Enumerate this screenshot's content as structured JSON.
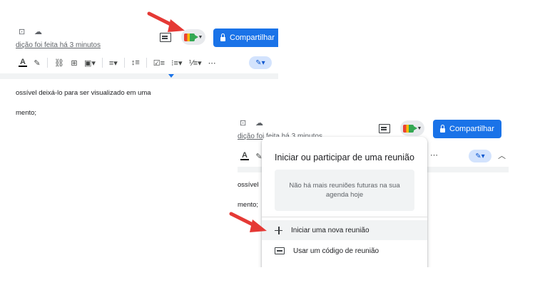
{
  "screen1": {
    "last_edit": "dição foi feita há 3 minutos",
    "share_label": "Compartilhar",
    "doc_line1": "ossível deixá-lo para ser visualizado em uma",
    "doc_line2": "mento;",
    "toolbar": {
      "text_color": "A",
      "more": "⋯"
    }
  },
  "screen2": {
    "last_edit": "dição foi feita há 3 minutos",
    "share_label": "Compartilhar",
    "doc_line1": "ossível",
    "doc_line2": "mento;",
    "toolbar": {
      "text_color": "A",
      "more": "⋯"
    },
    "popover": {
      "title": "Iniciar ou participar de uma reunião",
      "empty_message": "Não há mais reuniões futuras na sua agenda hoje",
      "items": [
        {
          "label": "Iniciar uma nova reunião",
          "icon": "plus-icon"
        },
        {
          "label": "Usar um código de reunião",
          "icon": "keyboard-icon"
        }
      ]
    }
  },
  "colors": {
    "accent": "#1a73e8",
    "arrow": "#e53935",
    "meet_red": "#ea4335",
    "meet_yellow": "#fbbc04",
    "meet_green": "#34a853"
  }
}
